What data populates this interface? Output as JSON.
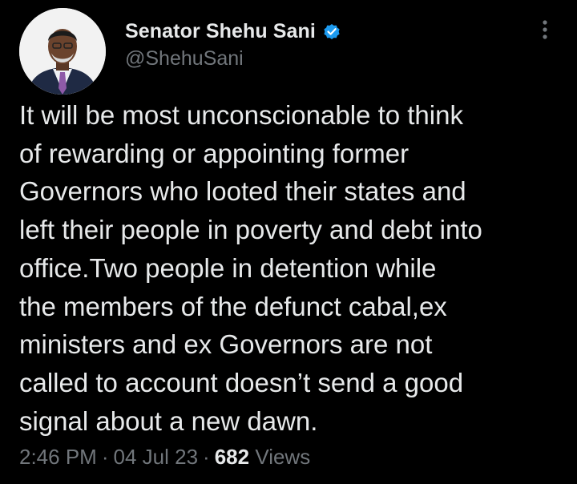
{
  "author": {
    "display_name": "Senator Shehu Sani",
    "handle": "@ShehuSani",
    "verified": true,
    "verified_color": "#1d9bf0"
  },
  "tweet": {
    "text": "It will be most unconscionable to think\nof rewarding or appointing former\nGovernors who looted their states and\nleft their people in poverty and debt into\noffice.Two people in detention while\nthe members of the defunct cabal,ex\nministers and ex Governors are not\ncalled to account doesn’t send a good\nsignal about a new dawn.",
    "time": "2:46 PM",
    "separator": "·",
    "date": "04 Jul 23",
    "views_count": "682",
    "views_label": "Views"
  },
  "icons": {
    "avatar": "profile-photo",
    "verified": "verified-badge-icon",
    "more": "more-vertical-icon"
  },
  "colors": {
    "background": "#000000",
    "primary_text": "#e7e9ea",
    "secondary_text": "#71767b"
  }
}
